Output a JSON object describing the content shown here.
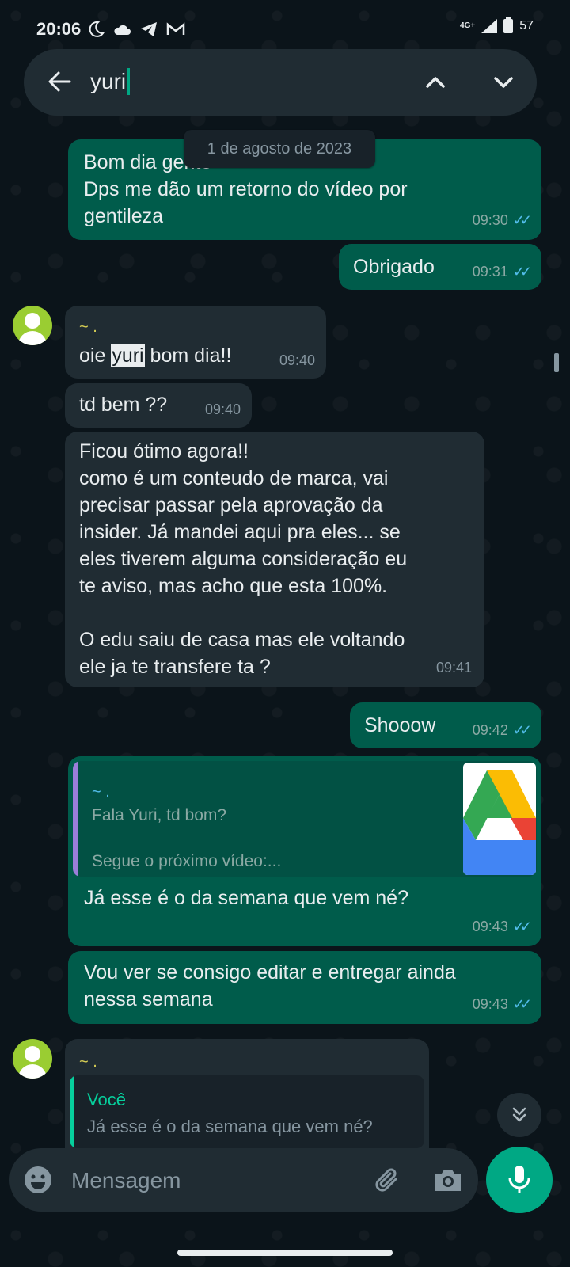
{
  "status_bar": {
    "time": "20:06",
    "network": "4G+",
    "battery": "57"
  },
  "search": {
    "query": "yuri"
  },
  "date_chip": "1 de agosto de 2023",
  "messages": [
    {
      "dir": "out",
      "line1": "Bom dia gente",
      "line2": "Dps me dão um retorno do vídeo por",
      "line3": "gentileza",
      "time": "09:30"
    },
    {
      "dir": "out",
      "text": "Obrigado",
      "time": "09:31"
    },
    {
      "dir": "in",
      "sender": "~ .",
      "pre": "oie ",
      "highlight": "yuri",
      "post": " bom dia!!",
      "time": "09:40"
    },
    {
      "dir": "in",
      "text": "td bem ??",
      "time": "09:40"
    },
    {
      "dir": "in",
      "lines": [
        "Ficou ótimo agora!!",
        "como é um conteudo de marca, vai",
        "precisar passar pela aprovação da",
        "insider. Já mandei aqui pra eles... se",
        "eles tiverem alguma consideração eu",
        "te aviso, mas acho que esta 100%.",
        "",
        "O edu saiu de casa mas ele voltando",
        "ele ja te transfere ta ?"
      ],
      "time": "09:41"
    },
    {
      "dir": "out",
      "text": "Shooow",
      "time": "09:42"
    },
    {
      "dir": "out",
      "quote": {
        "sender": "~ .",
        "line1": "Fala Yuri, td bom?",
        "line2": "Segue o próximo vídeo:..."
      },
      "text": "Já esse é o da semana que vem né?",
      "time": "09:43"
    },
    {
      "dir": "out",
      "line1": "Vou ver se consigo editar e entregar ainda",
      "line2": "nessa semana",
      "time": "09:43"
    },
    {
      "dir": "in",
      "sender": "~ .",
      "quote": {
        "sender": "Você",
        "text": "Já esse é o da semana que vem né?"
      }
    }
  ],
  "composer": {
    "placeholder": "Mensagem"
  },
  "colors": {
    "outgoing_bubble": "#005c4b",
    "incoming_bubble": "#202c33",
    "accent": "#00a884",
    "read_ticks": "#53bdeb"
  },
  "icons": [
    "back-arrow-icon",
    "chevron-up-icon",
    "chevron-down-icon",
    "emoji-icon",
    "attach-icon",
    "camera-icon",
    "mic-icon",
    "double-chevron-down-icon"
  ]
}
